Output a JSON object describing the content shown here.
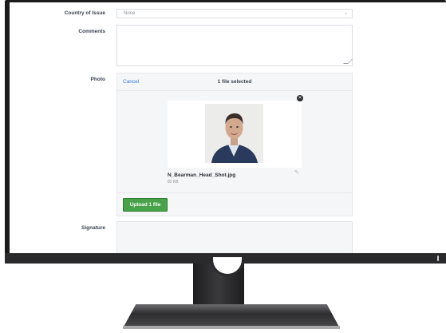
{
  "form": {
    "country": {
      "label": "Country of Issue",
      "value": "None"
    },
    "comments": {
      "label": "Comments",
      "value": ""
    },
    "photo": {
      "label": "Photo",
      "cancel": "Cancel",
      "status": "1 file selected",
      "file_name": "N_Bearman_Head_Shot.jpg",
      "file_size": "82 KB",
      "upload_button": "Upload 1 file"
    },
    "signature": {
      "label": "Signature"
    }
  },
  "colors": {
    "accent_link": "#3b77d8",
    "upload_green": "#48a24a",
    "monitor_bezel": "#1b1b1d"
  },
  "icons": [
    "chevron-down-icon",
    "close-icon",
    "pencil-icon",
    "resize-grip-icon",
    "power-indicator-icon"
  ]
}
